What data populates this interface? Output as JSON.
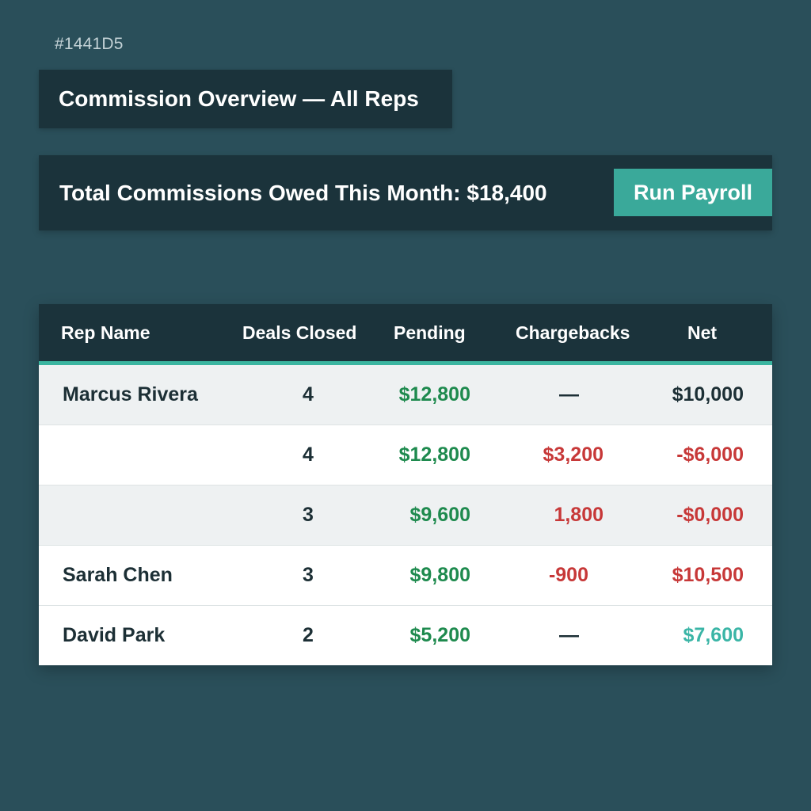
{
  "hex_label": "#1441D5",
  "title": "Commission Overview — All Reps",
  "summary": {
    "text": "Total Commissions Owed This Month: $18,400",
    "button_label": "Run Payroll"
  },
  "colors": {
    "background": "#2a4f5a",
    "panel": "#1b333b",
    "accent": "#3aa99a",
    "positive": "#1e8a4e",
    "negative": "#c73838"
  },
  "table": {
    "headers": [
      "Rep Name",
      "Deals Closed",
      "Pending",
      "Chargebacks",
      "Net"
    ],
    "rows": [
      {
        "name": "Marcus Rivera",
        "deals": "4",
        "pending": "$12,800",
        "chargebacks": "—",
        "net": "$10,000"
      },
      {
        "name": "",
        "deals": "4",
        "pending": "$12,800",
        "chargebacks": "$3,200",
        "net": "-$6,000"
      },
      {
        "name": "",
        "deals": "3",
        "pending": "$9,600",
        "chargebacks": "1,800",
        "net": "-$0,000"
      },
      {
        "name": "Sarah Chen",
        "deals": "3",
        "pending": "$9,800",
        "chargebacks": "-900",
        "net": "$10,500"
      },
      {
        "name": "David Park",
        "deals": "2",
        "pending": "$5,200",
        "chargebacks": "—",
        "net": "$7,600"
      }
    ]
  }
}
